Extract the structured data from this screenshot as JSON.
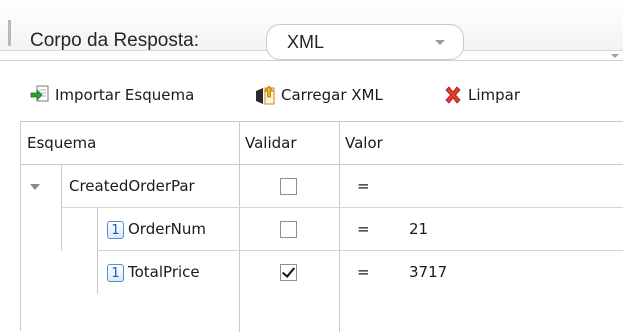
{
  "response_body": {
    "label": "Corpo da Resposta:",
    "format_value": "XML"
  },
  "toolbar": {
    "import_schema_label": "Importar Esquema",
    "load_xml_label": "Carregar XML",
    "clear_label": "Limpar"
  },
  "grid": {
    "columns": [
      "Esquema",
      "Validar",
      "Valor"
    ],
    "rows": [
      {
        "badge": "",
        "name": "CreatedOrderPar",
        "validate": false,
        "operator": "=",
        "value": ""
      },
      {
        "badge": "1",
        "name": "OrderNum",
        "validate": false,
        "operator": "=",
        "value": "21"
      },
      {
        "badge": "1",
        "name": "TotalPrice",
        "validate": true,
        "operator": "=",
        "value": "3717"
      }
    ]
  },
  "icons": {
    "import": "green-arrow-import-icon",
    "load": "document-arrow-load-icon",
    "clear": "red-x-icon",
    "badge_color": "#4a90d9"
  }
}
